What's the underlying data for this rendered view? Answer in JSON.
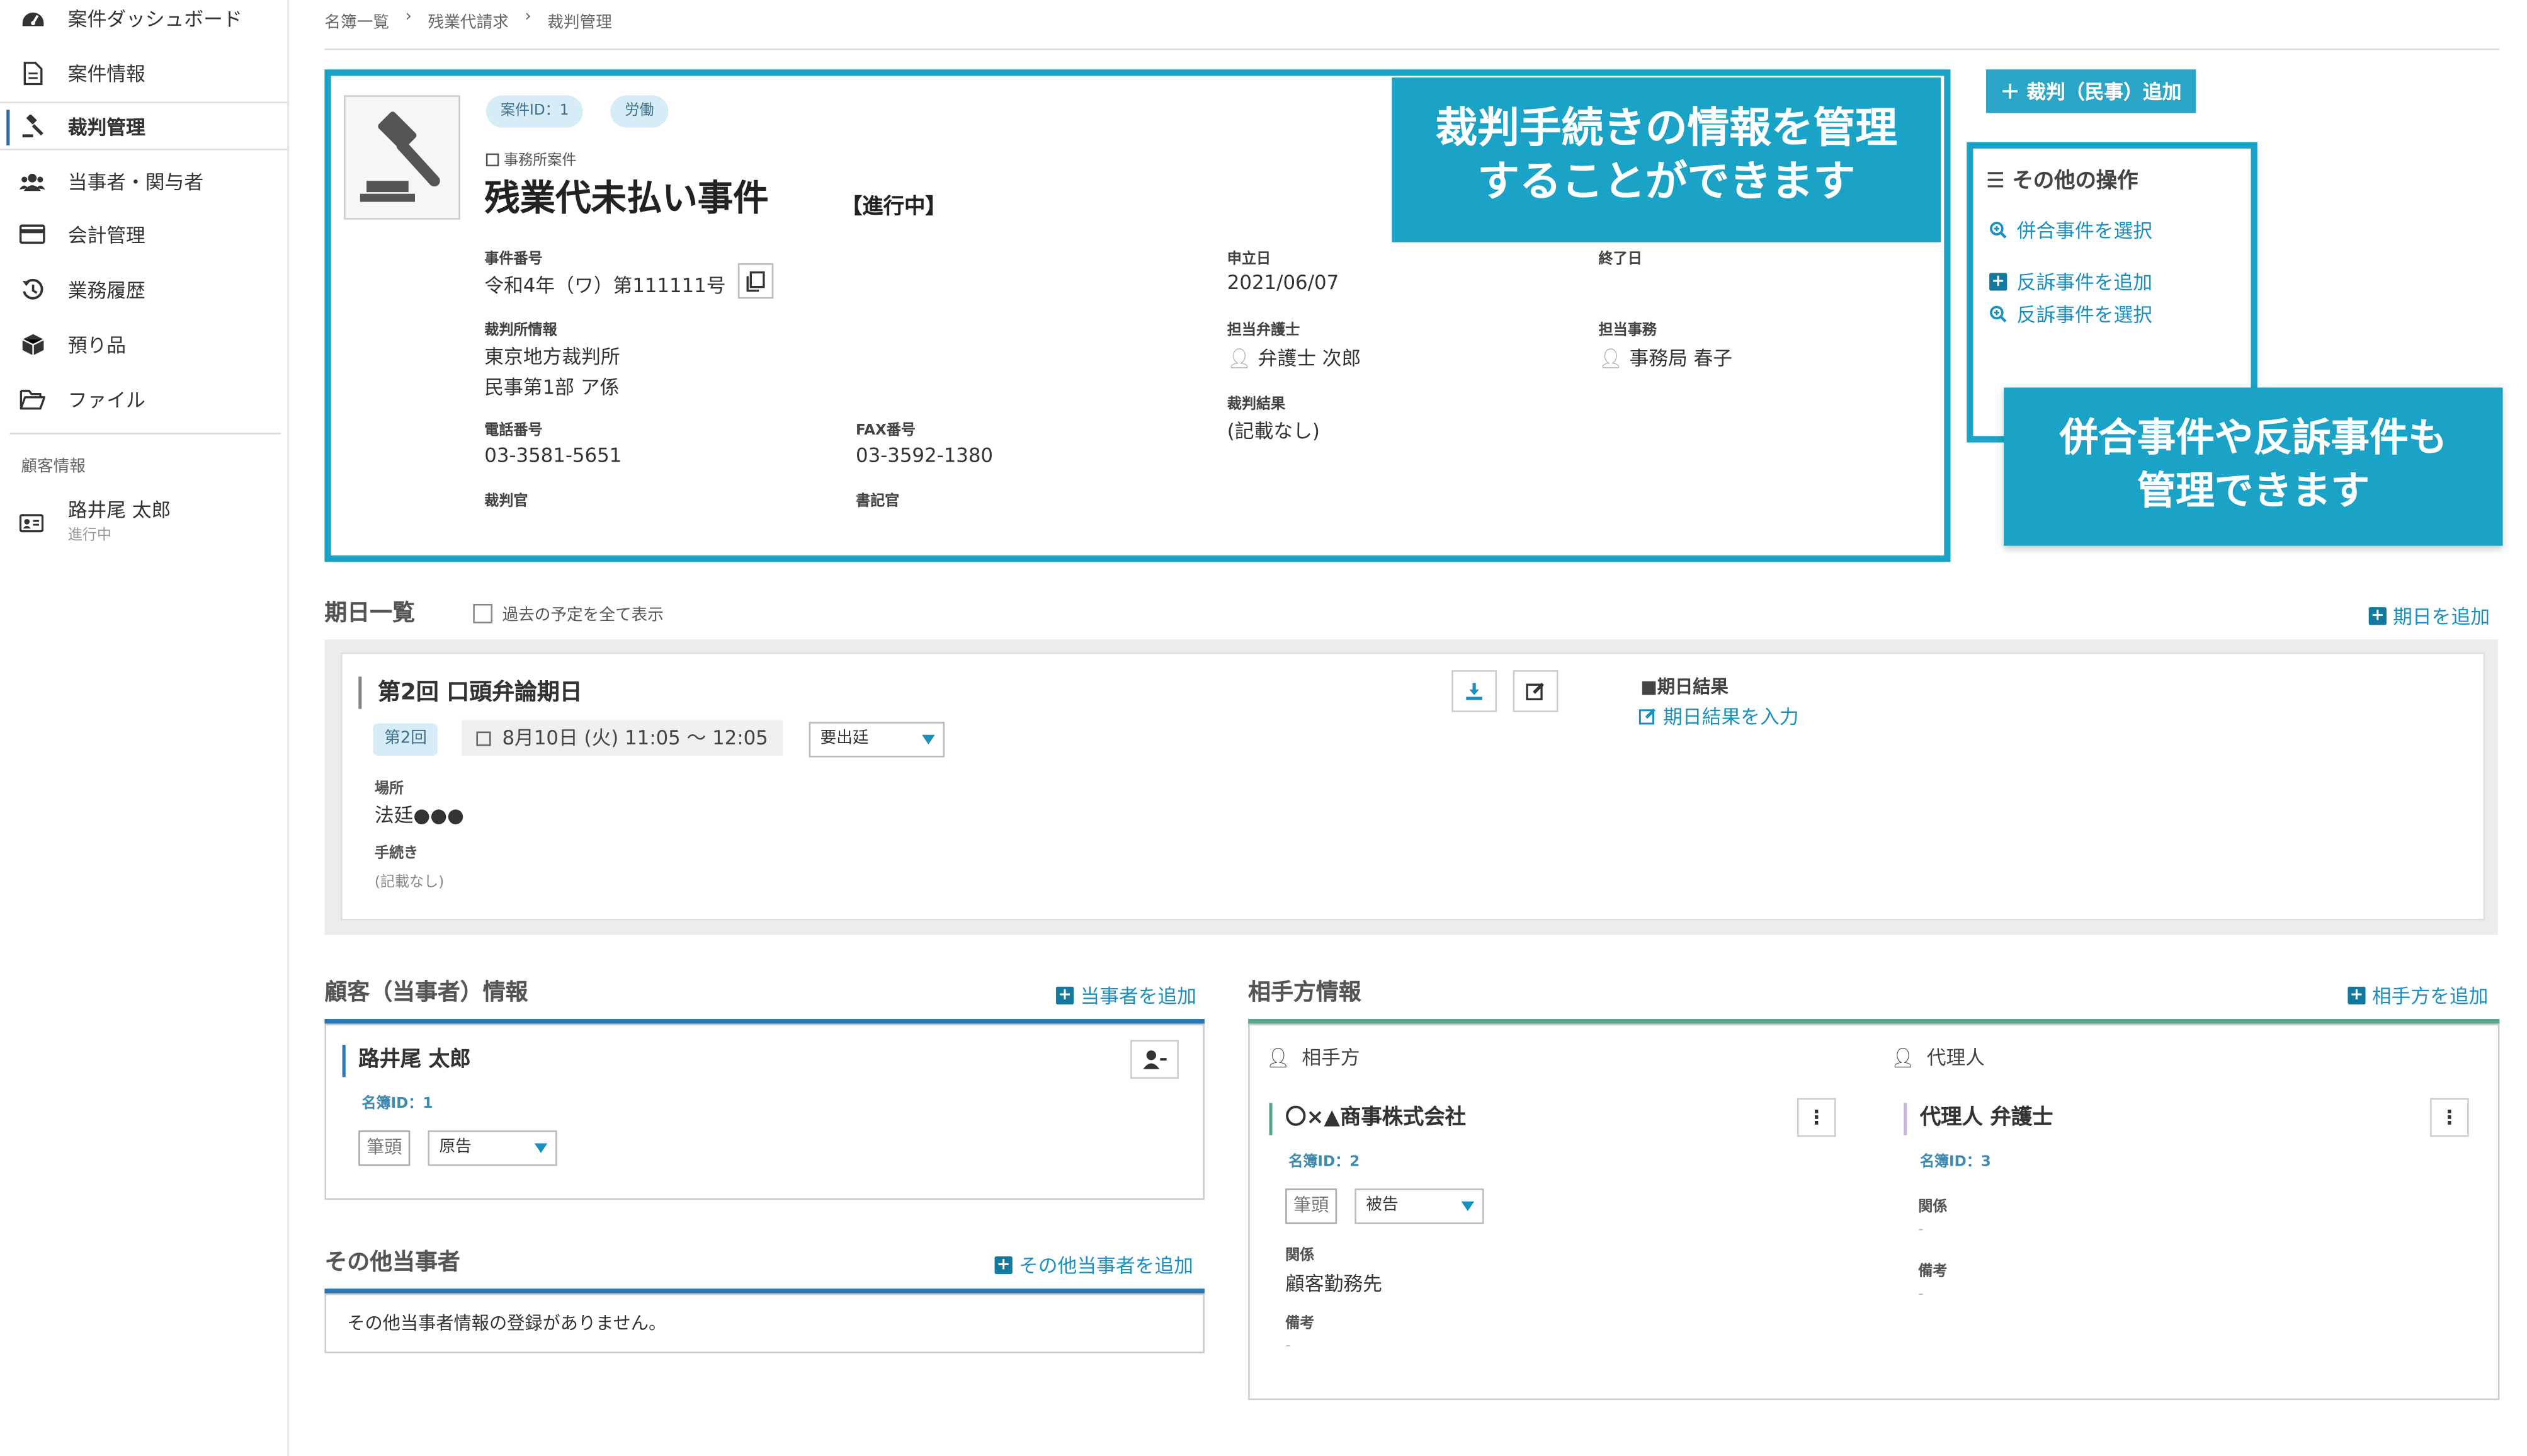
{
  "sidebar": {
    "items": [
      {
        "label": "案件ダッシュボード",
        "icon": "dashboard-icon"
      },
      {
        "label": "案件情報",
        "icon": "document-icon"
      },
      {
        "label": "裁判管理",
        "icon": "gavel-icon"
      },
      {
        "label": "当事者・関与者",
        "icon": "users-icon"
      },
      {
        "label": "会計管理",
        "icon": "card-icon"
      },
      {
        "label": "業務履歴",
        "icon": "history-icon"
      },
      {
        "label": "預り品",
        "icon": "box-icon"
      },
      {
        "label": "ファイル",
        "icon": "folder-icon"
      }
    ],
    "section_title": "顧客情報",
    "client": {
      "name": "路井尾 太郎",
      "status": "進行中"
    }
  },
  "breadcrumb": [
    "名簿一覧",
    "残業代請求",
    "裁判管理"
  ],
  "case": {
    "id_pill": "案件ID：1",
    "category_pill": "労働",
    "firm_label": "事務所案件",
    "title": "残業代未払い事件",
    "status": "【進行中】",
    "case_number_label": "事件番号",
    "case_number": "令和4年（ワ）第111111号",
    "filed_label": "申立日",
    "filed_date": "2021/06/07",
    "end_label": "終了日",
    "court_label": "裁判所情報",
    "court_name": "東京地方裁判所",
    "court_dept": "民事第1部 ア係",
    "lawyer_label": "担当弁護士",
    "lawyer": "弁護士 次郎",
    "clerk_label": "担当事務",
    "clerk": "事務局 春子",
    "result_label": "裁判結果",
    "result": "(記載なし)",
    "phone_label": "電話番号",
    "phone": "03-3581-5651",
    "fax_label": "FAX番号",
    "fax": "03-3592-1380",
    "judge_label": "裁判官",
    "secretary_label": "書記官"
  },
  "callouts": {
    "main_line1": "裁判手続きの情報を管理",
    "main_line2": "することができます",
    "side_line1": "併合事件や反訴事件も",
    "side_line2": "管理できます"
  },
  "actions": {
    "add_case": "＋ 裁判（民事）追加",
    "other_ops_title": "その他の操作",
    "links": [
      "併合事件を選択",
      "反訴事件を追加",
      "反訴事件を選択"
    ]
  },
  "schedule": {
    "title": "期日一覧",
    "show_past": "過去の予定を全て表示",
    "add_label": "期日を追加",
    "hearing_title": "第2回 口頭弁論期日",
    "round": "第2回",
    "datetime": "8月10日 (火) 11:05 ～ 12:05",
    "attendance": "要出廷",
    "place_label": "場所",
    "place": "法廷●●●",
    "procedure_label": "手続き",
    "procedure": "(記載なし)",
    "result_label": "■期日結果",
    "result_link": "期日結果を入力"
  },
  "client_section": {
    "title": "顧客（当事者）情報",
    "add_label": "当事者を追加",
    "name": "路井尾 太郎",
    "id": "名簿ID：1",
    "lead": "筆頭",
    "role": "原告"
  },
  "others_section": {
    "title": "その他当事者",
    "add_label": "その他当事者を追加",
    "empty": "その他当事者情報の登録がありません。"
  },
  "opponent_section": {
    "title": "相手方情報",
    "add_label": "相手方を追加",
    "col_opponent": "相手方",
    "col_agent": "代理人",
    "opponent": {
      "name": "〇×▲商事株式会社",
      "id": "名簿ID：2",
      "lead": "筆頭",
      "role": "被告",
      "relation_label": "関係",
      "relation": "顧客勤務先",
      "note_label": "備考",
      "note": "-"
    },
    "agent": {
      "name": "代理人 弁護士",
      "id": "名簿ID：3",
      "relation_label": "関係",
      "relation": "-",
      "note_label": "備考",
      "note": "-"
    }
  },
  "colors": {
    "accent": "#1aa3c6",
    "link": "#1a8fc0",
    "client_line": "#2b78b5",
    "opponent_line": "#5aa78e"
  }
}
